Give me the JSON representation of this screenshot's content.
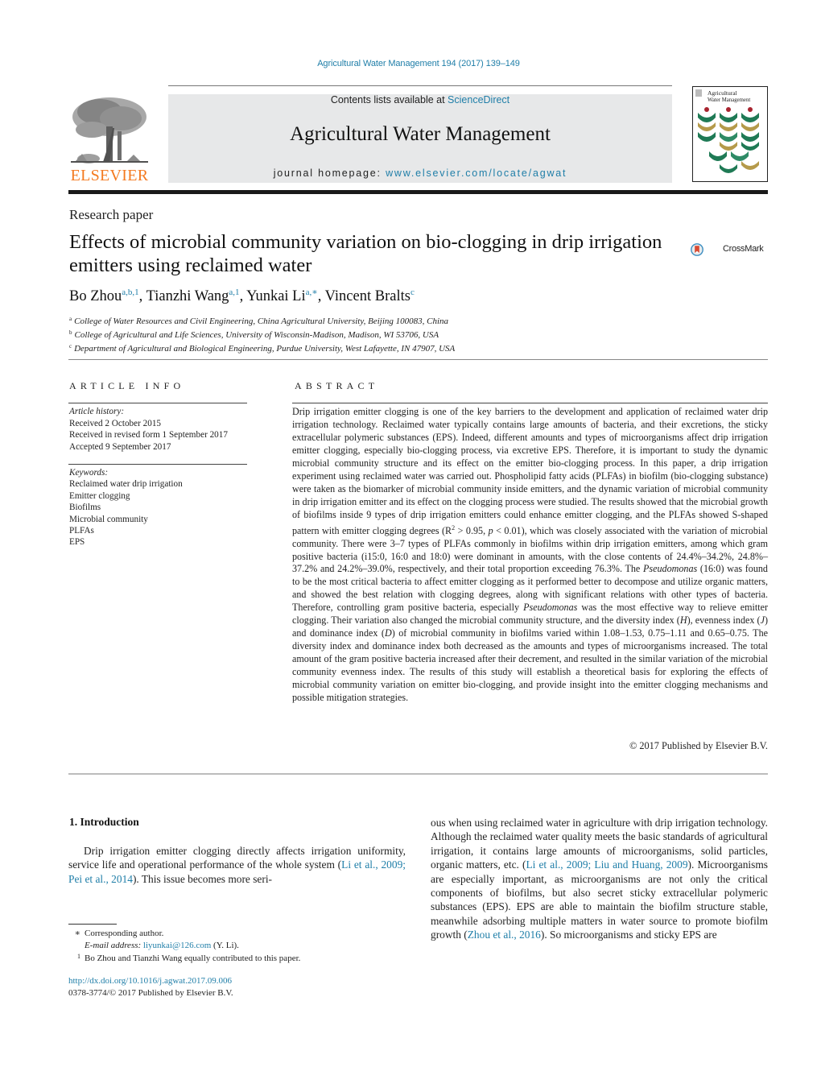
{
  "header": {
    "citation": "Agricultural Water Management 194 (2017) 139–149",
    "contents_prefix": "Contents lists available at ",
    "contents_link": "ScienceDirect",
    "journal_title": "Agricultural Water Management",
    "homepage_prefix": "journal homepage: ",
    "homepage_link": "www.elsevier.com/locate/agwat",
    "publisher_logo_text": "ELSEVIER",
    "cover_title_line1": "Agricultural",
    "cover_title_line2": "Water Management",
    "crossmark_label": "CrossMark"
  },
  "colors": {
    "link": "#1f7ea8",
    "elsevier_orange": "#f47a20",
    "masthead_bg": "#e7e8e9",
    "cover_green": "#1f7a55",
    "cover_gold": "#b59a4a",
    "cover_red": "#a8242f"
  },
  "article": {
    "type": "Research paper",
    "title": "Effects of microbial community variation on bio-clogging in drip irrigation emitters using reclaimed water",
    "authors": [
      {
        "name": "Bo Zhou",
        "sup": "a,b,1",
        "sep": ", "
      },
      {
        "name": "Tianzhi Wang",
        "sup": "a,1",
        "sep": ", "
      },
      {
        "name": "Yunkai Li",
        "sup": "a,∗",
        "sep": ", "
      },
      {
        "name": "Vincent Bralts",
        "sup": "c",
        "sep": ""
      }
    ],
    "affiliations": [
      {
        "mark": "a",
        "text": "College of Water Resources and Civil Engineering, China Agricultural University, Beijing 100083, China"
      },
      {
        "mark": "b",
        "text": "College of Agricultural and Life Sciences, University of Wisconsin-Madison, Madison, WI 53706, USA"
      },
      {
        "mark": "c",
        "text": "Department of Agricultural and Biological Engineering, Purdue University, West Lafayette, IN 47907, USA"
      }
    ]
  },
  "article_info": {
    "label": "ARTICLE INFO",
    "history_heading": "Article history:",
    "history": [
      "Received 2 October 2015",
      "Received in revised form 1 September 2017",
      "Accepted 9 September 2017"
    ],
    "keywords_heading": "Keywords:",
    "keywords": [
      "Reclaimed water drip irrigation",
      "Emitter clogging",
      "Biofilms",
      "Microbial community",
      "PLFAs",
      "EPS"
    ]
  },
  "abstract": {
    "label": "ABSTRACT",
    "p1": "Drip irrigation emitter clogging is one of the key barriers to the development and application of reclaimed water drip irrigation technology. Reclaimed water typically contains large amounts of bacteria, and their excretions, the sticky extracellular polymeric substances (EPS). Indeed, different amounts and types of microorganisms affect drip irrigation emitter clogging, especially bio-clogging process, via excretive EPS. Therefore, it is important to study the dynamic microbial community structure and its effect on the emit­ter bio-clogging process. In this paper, a drip irrigation experiment using reclaimed water was carried out. Phospholipid fatty acids (PLFAs) in biofilm (bio-clogging substance) were taken as the biomarker of microbial community inside emitters, and the dynamic variation of microbial community in drip irriga­tion emitter and its effect on the clogging process were studied. The results showed that the microbial growth of biofilms inside 9 types of drip irrigation emitters could enhance emitter clogging, and the PLFAs showed S-shaped pattern with emitter clogging degrees (R",
    "p1_sup": "2",
    "p2": " > 0.95, ",
    "p2_italic": "p",
    "p3": " < 0.01), which was closely associ­ated with the variation of microbial community. There were 3–7 types of PLFAs commonly in biofilms within drip irrigation emitters, among which gram positive bacteria (i15:0, 16:0 and 18:0) were dom­inant in amounts, with the close contents of 24.4%–34.2%, 24.8%–37.2% and 24.2%–39.0%, respectively, and their total proportion exceeding 76.3%. The ",
    "pseudomonas": "Pseudomonas",
    "p4": " (16:0) was found to be the most critical bacteria to affect emitter clogging as it performed better to decompose and utilize organic matters, and showed the best relation with clogging degrees, along with significant relations with other types of bac­teria. Therefore, controlling gram positive bacteria, especially ",
    "p5": " was the most effective way to relieve emitter clogging. Their variation also changed the microbial community structure, and the diver­sity index (",
    "H": "H",
    "p6": "), evenness index (",
    "J": "J",
    "p7": ") and dominance index (",
    "D": "D",
    "p8": ") of microbial community in biofilms varied within 1.08–1.53, 0.75–1.11 and 0.65–0.75. The diversity index and dominance index both decreased as the amounts and types of microorganisms increased. The total amount of the gram positive bacteria increased after their decrement, and resulted in the similar variation of the microbial community even­ness index. The results of this study will establish a theoretical basis for exploring the effects of microbial community variation on emitter bio-clogging, and provide insight into the emitter clogging mechanisms and possible mitigation strategies.",
    "copyright": "© 2017 Published by Elsevier B.V."
  },
  "introduction": {
    "heading": "1.  Introduction",
    "c1_text1": "Drip irrigation emitter clogging directly affects irrigation unifor­mity, service life and operational performance of the whole system (",
    "c1_link1": "Li et al., 2009; Pei et al., 2014",
    "c1_text2": "). This issue becomes more seri-",
    "c2_text1": "ous when using reclaimed water in agriculture with drip irrigation technology. Although the reclaimed water quality meets the basic standards of agricultural irrigation, it contains large amounts of microorganisms, solid particles, organic matters, etc. (",
    "c2_link1": "Li et al., 2009; Liu and Huang, 2009",
    "c2_text2": "). Microorganisms are especially important, as microorganisms are not only the critical components of biofilms, but also secret sticky extracellular polymeric substances (EPS). EPS are able to maintain the biofilm structure stable, meanwhile adsorbing multiple matters in water source to promote biofilm growth (",
    "c2_link2": "Zhou et al., 2016",
    "c2_text3": "). So microorganisms and sticky EPS are"
  },
  "footnotes": {
    "star_mark": "∗",
    "star_text": "Corresponding author.",
    "email_label": "E-mail address: ",
    "email": "liyunkai@126.com",
    "email_suffix": " (Y. Li).",
    "one_mark": "1",
    "one_text": "Bo Zhou and Tianzhi Wang equally contributed to this paper.",
    "doi": "http://dx.doi.org/10.1016/j.agwat.2017.09.006",
    "issn_line": "0378-3774/© 2017 Published by Elsevier B.V."
  }
}
